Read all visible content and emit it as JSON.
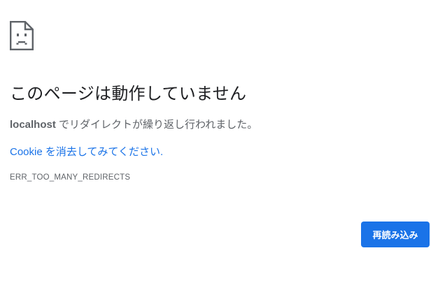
{
  "error_page": {
    "icon": "sad-page-icon",
    "title": "このページは動作していません",
    "message": {
      "host": "localhost",
      "text": " でリダイレクトが繰り返し行われました。"
    },
    "cookie": {
      "link_text": "Cookie を消去してみてください",
      "suffix": "."
    },
    "error_code": "ERR_TOO_MANY_REDIRECTS",
    "reload_button_label": "再読み込み"
  },
  "colors": {
    "accent": "#1a73e8",
    "title_text": "#202124",
    "body_text": "#5f6368",
    "icon_stroke": "#5f6368",
    "background": "#ffffff"
  }
}
